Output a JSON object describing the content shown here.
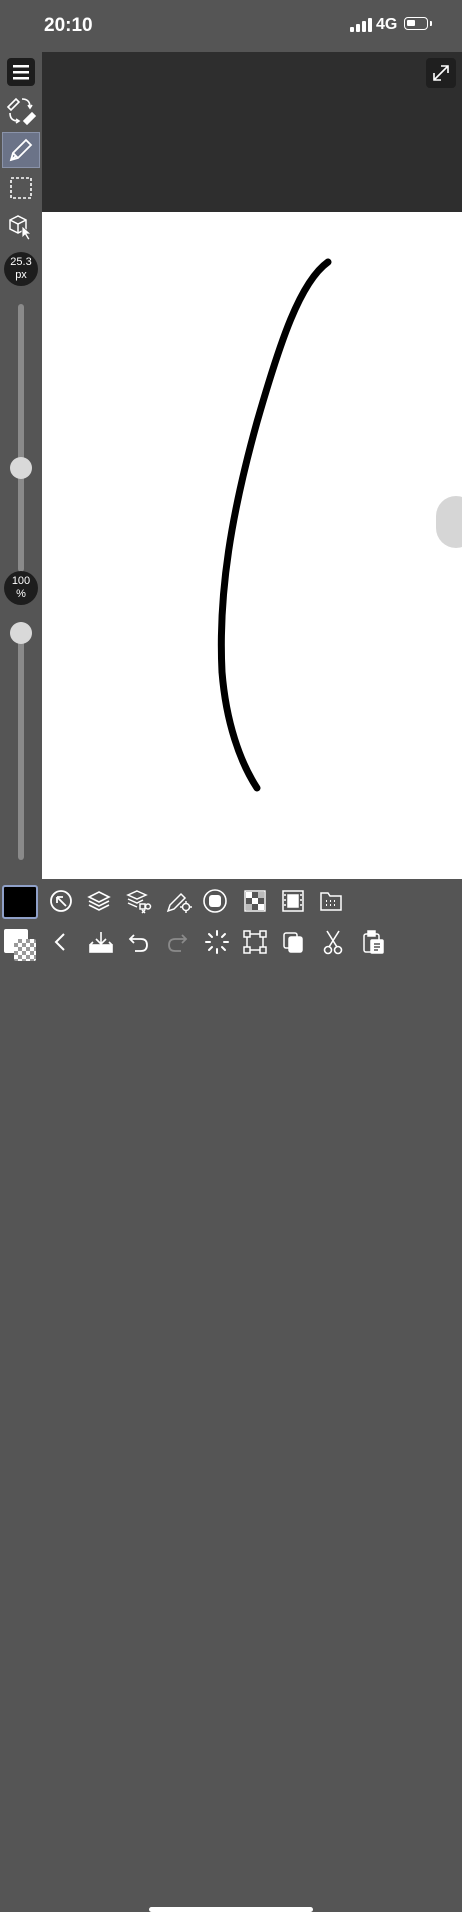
{
  "status_bar": {
    "time": "20:10",
    "network": "4G"
  },
  "left_toolbar": {
    "brush_size": {
      "value": "25.3",
      "unit": "px",
      "level": 0.38
    },
    "opacity": {
      "value": "100",
      "unit": "%",
      "level": 1.0
    }
  },
  "colors": {
    "main_color": "#000000",
    "sub_color": "#ffffff",
    "active_tool": "#6b7388"
  },
  "icons": {
    "left": [
      "menu-icon",
      "pen-eraser-swap-icon",
      "pen-icon",
      "selection-icon",
      "object-select-icon"
    ],
    "bottom_row1": [
      "color-wheel-icon",
      "layers-icon",
      "layer-properties-icon",
      "tool-settings-icon",
      "sub-tool-icon",
      "color-palette-icon",
      "animation-icon",
      "material-icon"
    ],
    "bottom_row2": [
      "back-icon",
      "save-icon",
      "undo-icon",
      "redo-icon",
      "loading-icon",
      "transform-icon",
      "copy-icon",
      "cut-icon",
      "paste-icon"
    ]
  }
}
